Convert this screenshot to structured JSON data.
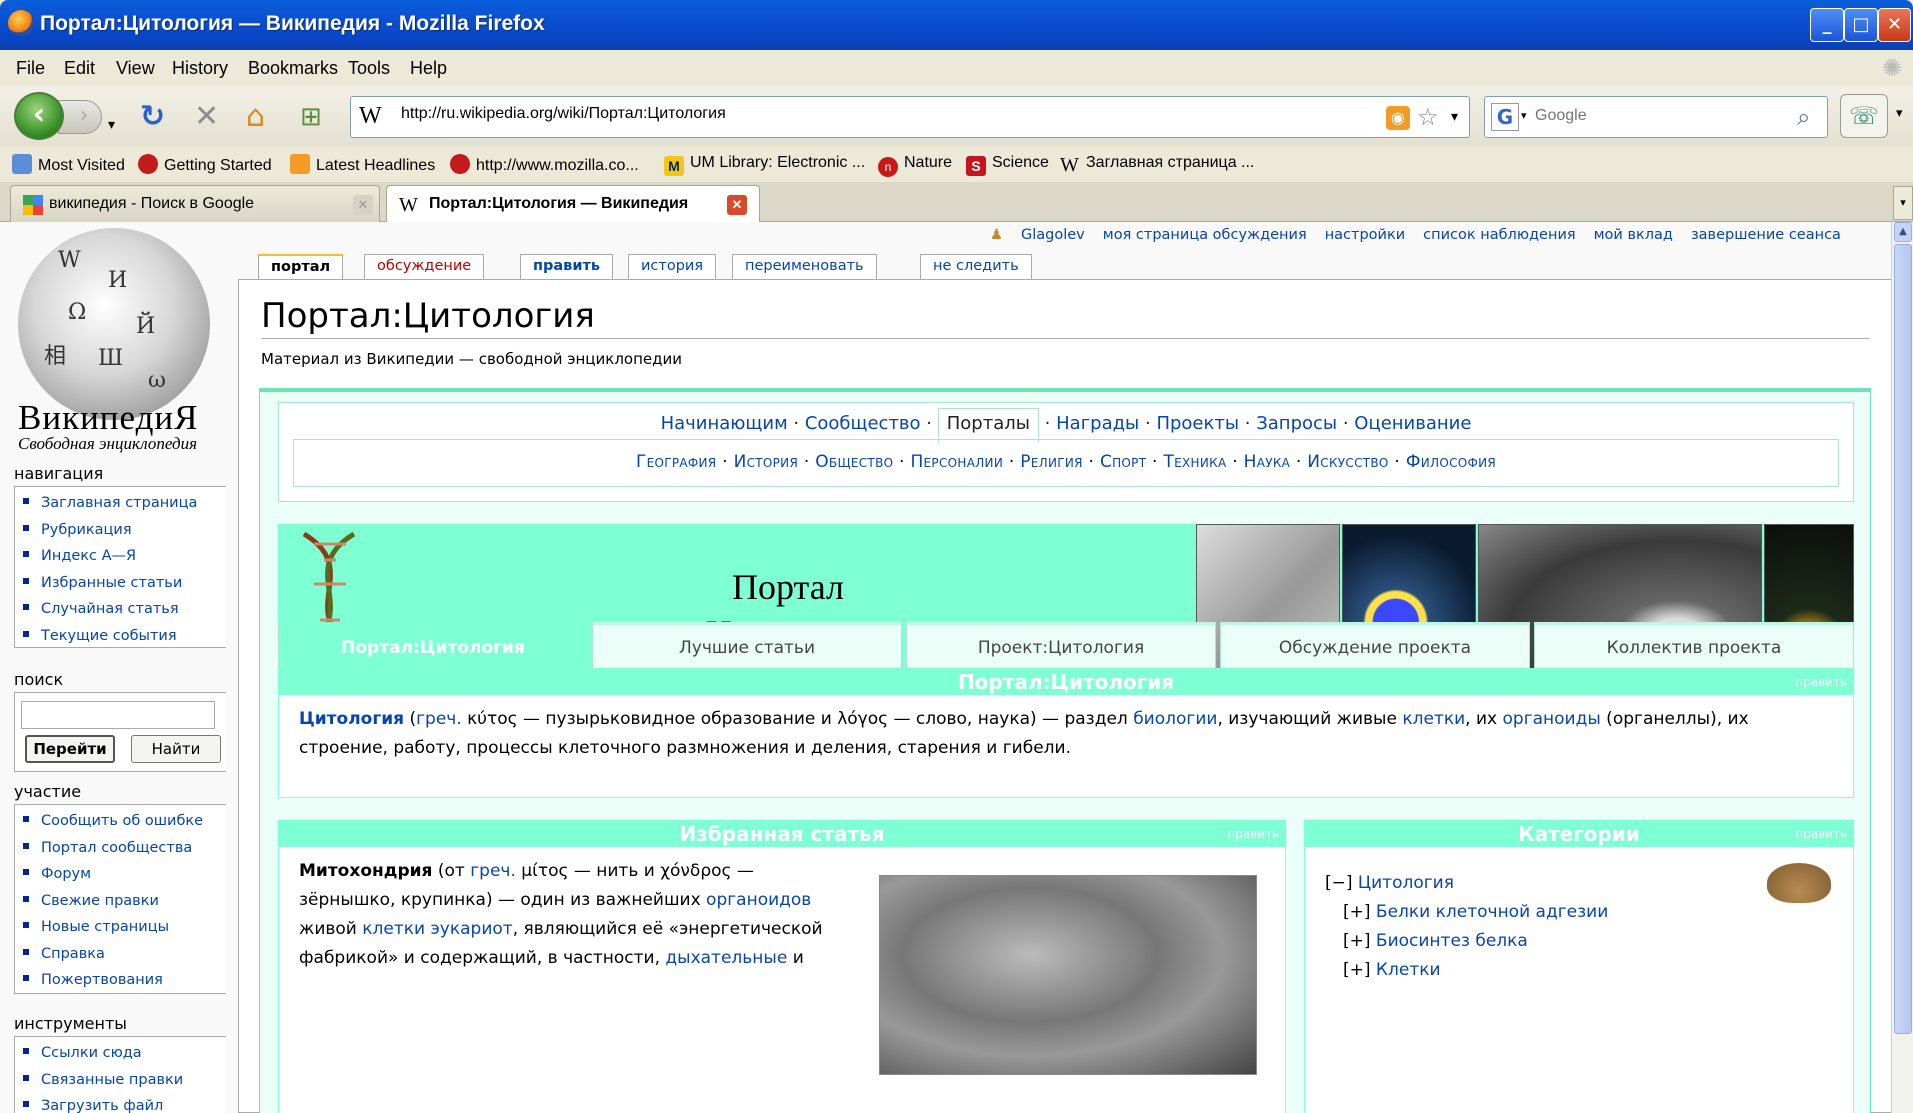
{
  "window": {
    "title": "Портал:Цитология — Википедия - Mozilla Firefox"
  },
  "menu": [
    "File",
    "Edit",
    "View",
    "History",
    "Bookmarks",
    "Tools",
    "Help"
  ],
  "nav": {
    "url": "http://ru.wikipedia.org/wiki/Портал:Цитология",
    "search_placeholder": "Google"
  },
  "bookmarks": [
    "Most Visited",
    "Getting Started",
    "Latest Headlines",
    "http://www.mozilla.co...",
    "UM Library: Electronic ...",
    "Nature",
    "Science",
    "Заглавная страница ..."
  ],
  "tabs": [
    {
      "title": "википедия - Поиск в Google"
    },
    {
      "title": "Портал:Цитология — Википедия"
    }
  ],
  "user_links": [
    "Glagolev",
    "моя страница обсуждения",
    "настройки",
    "список наблюдения",
    "мой вклад",
    "завершение сеанса"
  ],
  "page_tabs": [
    "портал",
    "обсуждение",
    "править",
    "история",
    "переименовать",
    "не следить"
  ],
  "logo": {
    "name": "ВикипедиЯ",
    "tagline": "Свободная энциклопедия"
  },
  "sidebar": {
    "navigation_title": "навигация",
    "navigation": [
      "Заглавная страница",
      "Рубрикация",
      "Индекс А—Я",
      "Избранные статьи",
      "Случайная статья",
      "Текущие события"
    ],
    "search_title": "поиск",
    "go_button": "Перейти",
    "search_button": "Найти",
    "participation_title": "участие",
    "participation": [
      "Сообщить об ошибке",
      "Портал сообщества",
      "Форум",
      "Свежие правки",
      "Новые страницы",
      "Справка",
      "Пожертвования"
    ],
    "tools_title": "инструменты",
    "tools": [
      "Ссылки сюда",
      "Связанные правки",
      "Загрузить файл"
    ]
  },
  "article": {
    "title": "Портал:Цитология",
    "subtitle": "Материал из Википедии — свободной энциклопедии"
  },
  "portal": {
    "nav_top": [
      "Начинающим",
      "Сообщество",
      "Порталы",
      "Награды",
      "Проекты",
      "Запросы",
      "Оценивание"
    ],
    "nav_top_current": "Порталы",
    "nav_topics": [
      "География",
      "История",
      "Общество",
      "Персоналии",
      "Религия",
      "Спорт",
      "Техника",
      "Наука",
      "Искусство",
      "Философия"
    ],
    "banner_line1": "Портал",
    "banner_line2": "«Цитология»",
    "tabs": [
      "Портал:Цитология",
      "Лучшие статьи",
      "Проект:Цитология",
      "Обсуждение проекта",
      "Коллектив проекта"
    ],
    "intro_header": "Портал:Цитология",
    "edit_label": "править",
    "intro": {
      "term": "Цитология",
      "p1": " (",
      "greek_link": "греч.",
      "p2": " κύτος — пузырьковидное образование и λόγος — слово, наука) — раздел ",
      "link1": "биологии",
      "p3": ", изучающий живые ",
      "link2": "клетки",
      "p4": ", их ",
      "link3": "органоиды",
      "p5": " (органеллы), их строение, работу, процессы клеточного размножения и деления, старения и гибели."
    },
    "featured_header": "Избранная статья",
    "featured": {
      "term": "Митохондрия",
      "p1": " (от ",
      "greek_link": "греч.",
      "p2": " μίτος — нить и χόνδρος — зёрнышко, крупинка) — один из важнейших ",
      "link1": "органоидов",
      "p3": " живой ",
      "link2": "клетки",
      "p4": " ",
      "link3": "эукариот",
      "p5": ", являющийся её «энергетической фабрикой» и содержащий, в частности, ",
      "link4": "дыхательные",
      "p6": " и"
    },
    "categories_header": "Категории",
    "categories": {
      "root_marker": "[−]",
      "root": "Цитология",
      "children": [
        {
          "marker": "[+]",
          "name": "Белки клеточной адгезии"
        },
        {
          "marker": "[+]",
          "name": "Биосинтез белка"
        },
        {
          "marker": "[+]",
          "name": "Клетки"
        }
      ]
    }
  }
}
